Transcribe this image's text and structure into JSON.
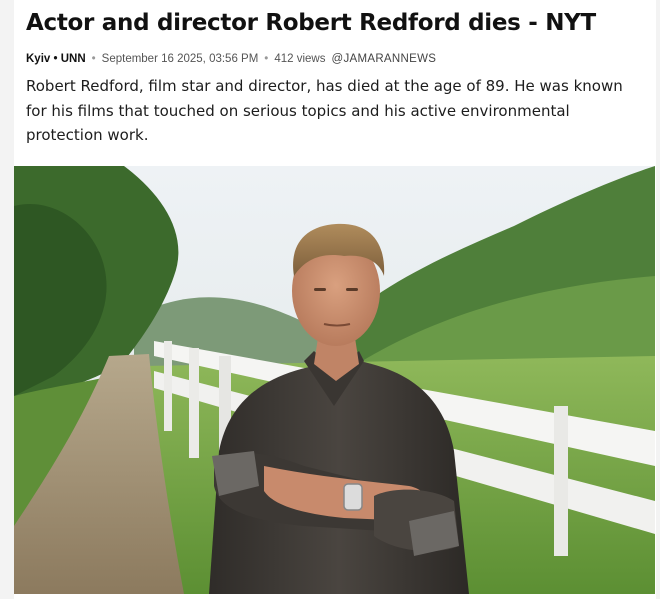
{
  "article": {
    "headline": "Actor and director Robert Redford dies - NYT",
    "meta": {
      "source": "Kyiv • UNN",
      "separator": "•",
      "datetime": "September 16 2025, 03:56 PM",
      "views": "412 views",
      "handle": "@JAMARANNEWS"
    },
    "lede": "Robert Redford, film star and director, has died at the age of 89. He was known for his films that touched on serious topics and his active environmental protection work."
  },
  "colors": {
    "sky": "#e9eef2",
    "grass": "#7fae4e",
    "shirt": "#3e3a36",
    "hair": "#9a7b52",
    "fence": "#f4f4f4"
  }
}
